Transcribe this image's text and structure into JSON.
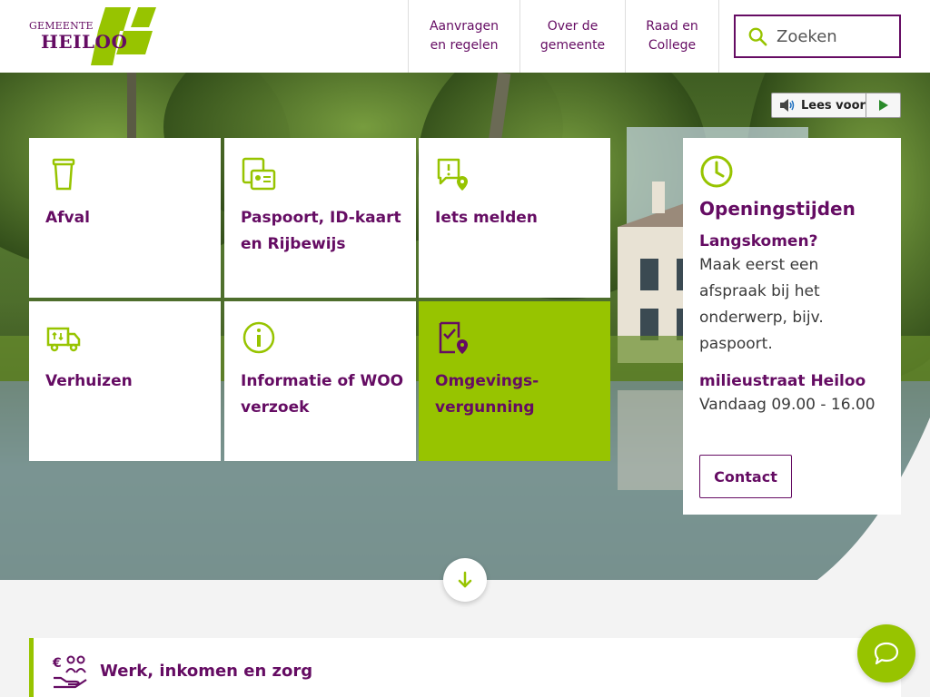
{
  "header": {
    "logo": {
      "top": "GEMEENTE",
      "main": "HEILOO"
    },
    "nav": [
      {
        "label": "Aanvragen\nen regelen"
      },
      {
        "label": "Over de\ngemeente"
      },
      {
        "label": "Raad en\nCollege"
      }
    ],
    "search": {
      "placeholder": "Zoeken"
    }
  },
  "readspeaker": {
    "label": "Lees voor"
  },
  "tiles": [
    {
      "label": "Afval",
      "icon": "trash-bin-icon"
    },
    {
      "label": "Paspoort, ID-kaart\nen Rijbewijs",
      "icon": "id-documents-icon"
    },
    {
      "label": "Iets melden",
      "icon": "report-location-icon"
    },
    {
      "label": "Verhuizen",
      "icon": "moving-truck-icon"
    },
    {
      "label": "Informatie of WOO\nverzoek",
      "icon": "info-icon"
    },
    {
      "label": "Omgevings-\nvergunning",
      "icon": "permit-location-icon"
    }
  ],
  "hours": {
    "title": "Openingstijden",
    "subtitle": "Langskomen?",
    "text": "Maak eerst een afspraak bij het onderwerp, bijv. paspoort.",
    "location": "milieustraat Heiloo",
    "time": "Vandaag 09.00 - 16.00",
    "contact_label": "Contact"
  },
  "section": {
    "title": "Werk, inkomen en zorg",
    "icon": "euro-people-hand-icon"
  },
  "colors": {
    "purple": "#650c63",
    "green": "#97c400"
  }
}
